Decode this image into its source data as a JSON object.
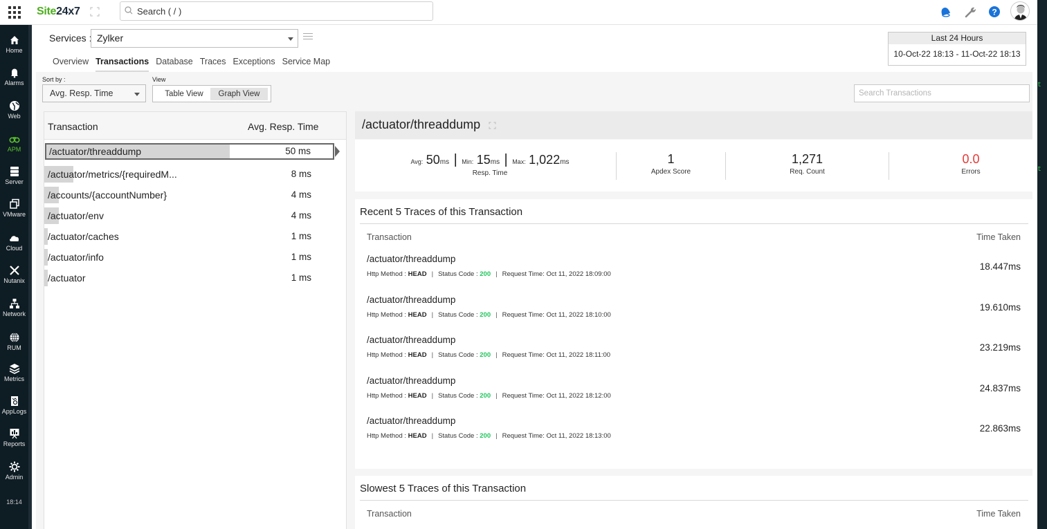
{
  "header": {
    "logo_site": "Site",
    "logo_247": "24x7",
    "search_placeholder": "Search ( / )",
    "icons": [
      "apps-grid-icon",
      "expand-icon",
      "search-icon",
      "notification-bell-icon",
      "wrench-icon",
      "help-icon",
      "user-avatar"
    ]
  },
  "sidebar": {
    "items": [
      {
        "label": "Home",
        "icon": "home-icon"
      },
      {
        "label": "Alarms",
        "icon": "bell-icon"
      },
      {
        "label": "Web",
        "icon": "globe-icon"
      },
      {
        "label": "APM",
        "icon": "binoculars-icon",
        "active": true
      },
      {
        "label": "Server",
        "icon": "server-icon"
      },
      {
        "label": "VMware",
        "icon": "vmware-icon"
      },
      {
        "label": "Cloud",
        "icon": "cloud-icon"
      },
      {
        "label": "Nutanix",
        "icon": "nutanix-icon"
      },
      {
        "label": "Network",
        "icon": "network-icon"
      },
      {
        "label": "RUM",
        "icon": "rum-globe-icon"
      },
      {
        "label": "Metrics",
        "icon": "layers-icon"
      },
      {
        "label": "AppLogs",
        "icon": "applogs-icon"
      },
      {
        "label": "Reports",
        "icon": "reports-icon"
      },
      {
        "label": "Admin",
        "icon": "gear-icon"
      }
    ],
    "time": "18:14"
  },
  "services": {
    "label": "Services :",
    "selected": "Zylker"
  },
  "tabs": [
    {
      "label": "Overview"
    },
    {
      "label": "Transactions",
      "active": true
    },
    {
      "label": "Database"
    },
    {
      "label": "Traces"
    },
    {
      "label": "Exceptions"
    },
    {
      "label": "Service Map"
    }
  ],
  "time_range": {
    "title": "Last 24 Hours",
    "range": "10-Oct-22 18:13 - 11-Oct-22 18:13"
  },
  "toolbar": {
    "sort_label": "Sort by :",
    "sort_value": "Avg. Resp. Time",
    "view_label": "View",
    "table_view": "Table View",
    "graph_view": "Graph View",
    "active_view": "Graph View",
    "search_placeholder": "Search Transactions"
  },
  "transactions": {
    "col_transaction": "Transaction",
    "col_avg": "Avg. Resp. Time",
    "rows": [
      {
        "name": "/actuator/threaddump",
        "avg": "50 ms",
        "value_ms": 50,
        "selected": true
      },
      {
        "name": "/actuator/metrics/{requiredM...",
        "avg": "8 ms",
        "value_ms": 8
      },
      {
        "name": "/accounts/{accountNumber}",
        "avg": "4 ms",
        "value_ms": 4
      },
      {
        "name": "/actuator/env",
        "avg": "4 ms",
        "value_ms": 4
      },
      {
        "name": "/actuator/caches",
        "avg": "1 ms",
        "value_ms": 1
      },
      {
        "name": "/actuator/info",
        "avg": "1 ms",
        "value_ms": 1
      },
      {
        "name": "/actuator",
        "avg": "1 ms",
        "value_ms": 1
      }
    ]
  },
  "detail": {
    "title": "/actuator/threaddump",
    "resp": {
      "avg_label": "Avg:",
      "avg": "50",
      "min_label": "Min:",
      "min": "15",
      "max_label": "Max:",
      "max": "1,022",
      "unit": "ms",
      "caption": "Resp. Time"
    },
    "apdex": {
      "value": "1",
      "caption": "Apdex Score"
    },
    "req_count": {
      "value": "1,271",
      "caption": "Req. Count"
    },
    "errors": {
      "value": "0.0",
      "caption": "Errors",
      "color": "#e53935"
    }
  },
  "recent": {
    "title": "Recent 5 Traces of this Transaction",
    "col_transaction": "Transaction",
    "col_time": "Time Taken",
    "method_label": "Http Method :",
    "status_label": "Status Code :",
    "request_label": "Request Time:",
    "traces": [
      {
        "name": "/actuator/threaddump",
        "method": "HEAD",
        "status": "200",
        "request_time": "Oct 11, 2022 18:09:00",
        "time_taken": "18.447ms"
      },
      {
        "name": "/actuator/threaddump",
        "method": "HEAD",
        "status": "200",
        "request_time": "Oct 11, 2022 18:10:00",
        "time_taken": "19.610ms"
      },
      {
        "name": "/actuator/threaddump",
        "method": "HEAD",
        "status": "200",
        "request_time": "Oct 11, 2022 18:11:00",
        "time_taken": "23.219ms"
      },
      {
        "name": "/actuator/threaddump",
        "method": "HEAD",
        "status": "200",
        "request_time": "Oct 11, 2022 18:12:00",
        "time_taken": "24.837ms"
      },
      {
        "name": "/actuator/threaddump",
        "method": "HEAD",
        "status": "200",
        "request_time": "Oct 11, 2022 18:13:00",
        "time_taken": "22.863ms"
      }
    ]
  },
  "slowest": {
    "title": "Slowest 5 Traces of this Transaction",
    "col_transaction": "Transaction",
    "col_time": "Time Taken"
  },
  "colors": {
    "brand_green": "#4caf1d",
    "apm_active": "#59c22b",
    "status_ok": "#22c55e",
    "error_red": "#e53935",
    "help_blue": "#1a73d9"
  }
}
